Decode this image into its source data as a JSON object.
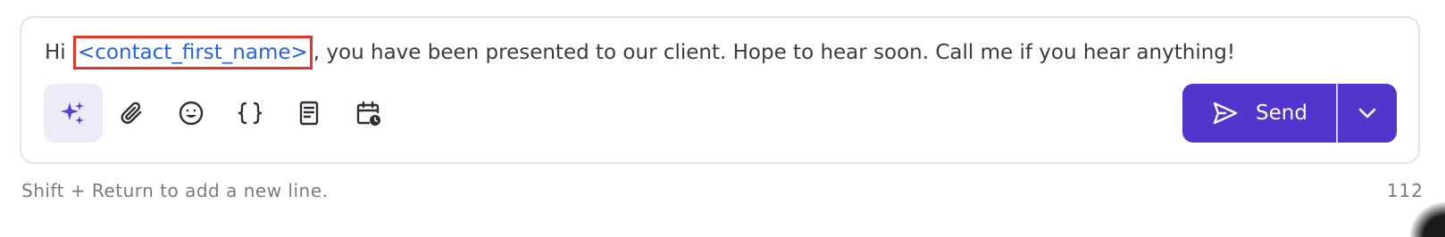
{
  "composer": {
    "message": {
      "prefix": "Hi ",
      "token": "<contact_first_name>",
      "suffix": ", you have been presented to our client. Hope to hear soon. Call me if you hear anything!"
    },
    "toolbar": {
      "icons": [
        "sparkles-icon",
        "paperclip-icon",
        "emoji-icon",
        "braces-icon",
        "document-icon",
        "calendar-clock-icon"
      ]
    },
    "send": {
      "label": "Send"
    }
  },
  "footer": {
    "hint": "Shift + Return to add a new line.",
    "char_count": "112"
  },
  "colors": {
    "accent": "#5235cc",
    "token_text": "#2563d6",
    "token_highlight": "#e0392b"
  }
}
